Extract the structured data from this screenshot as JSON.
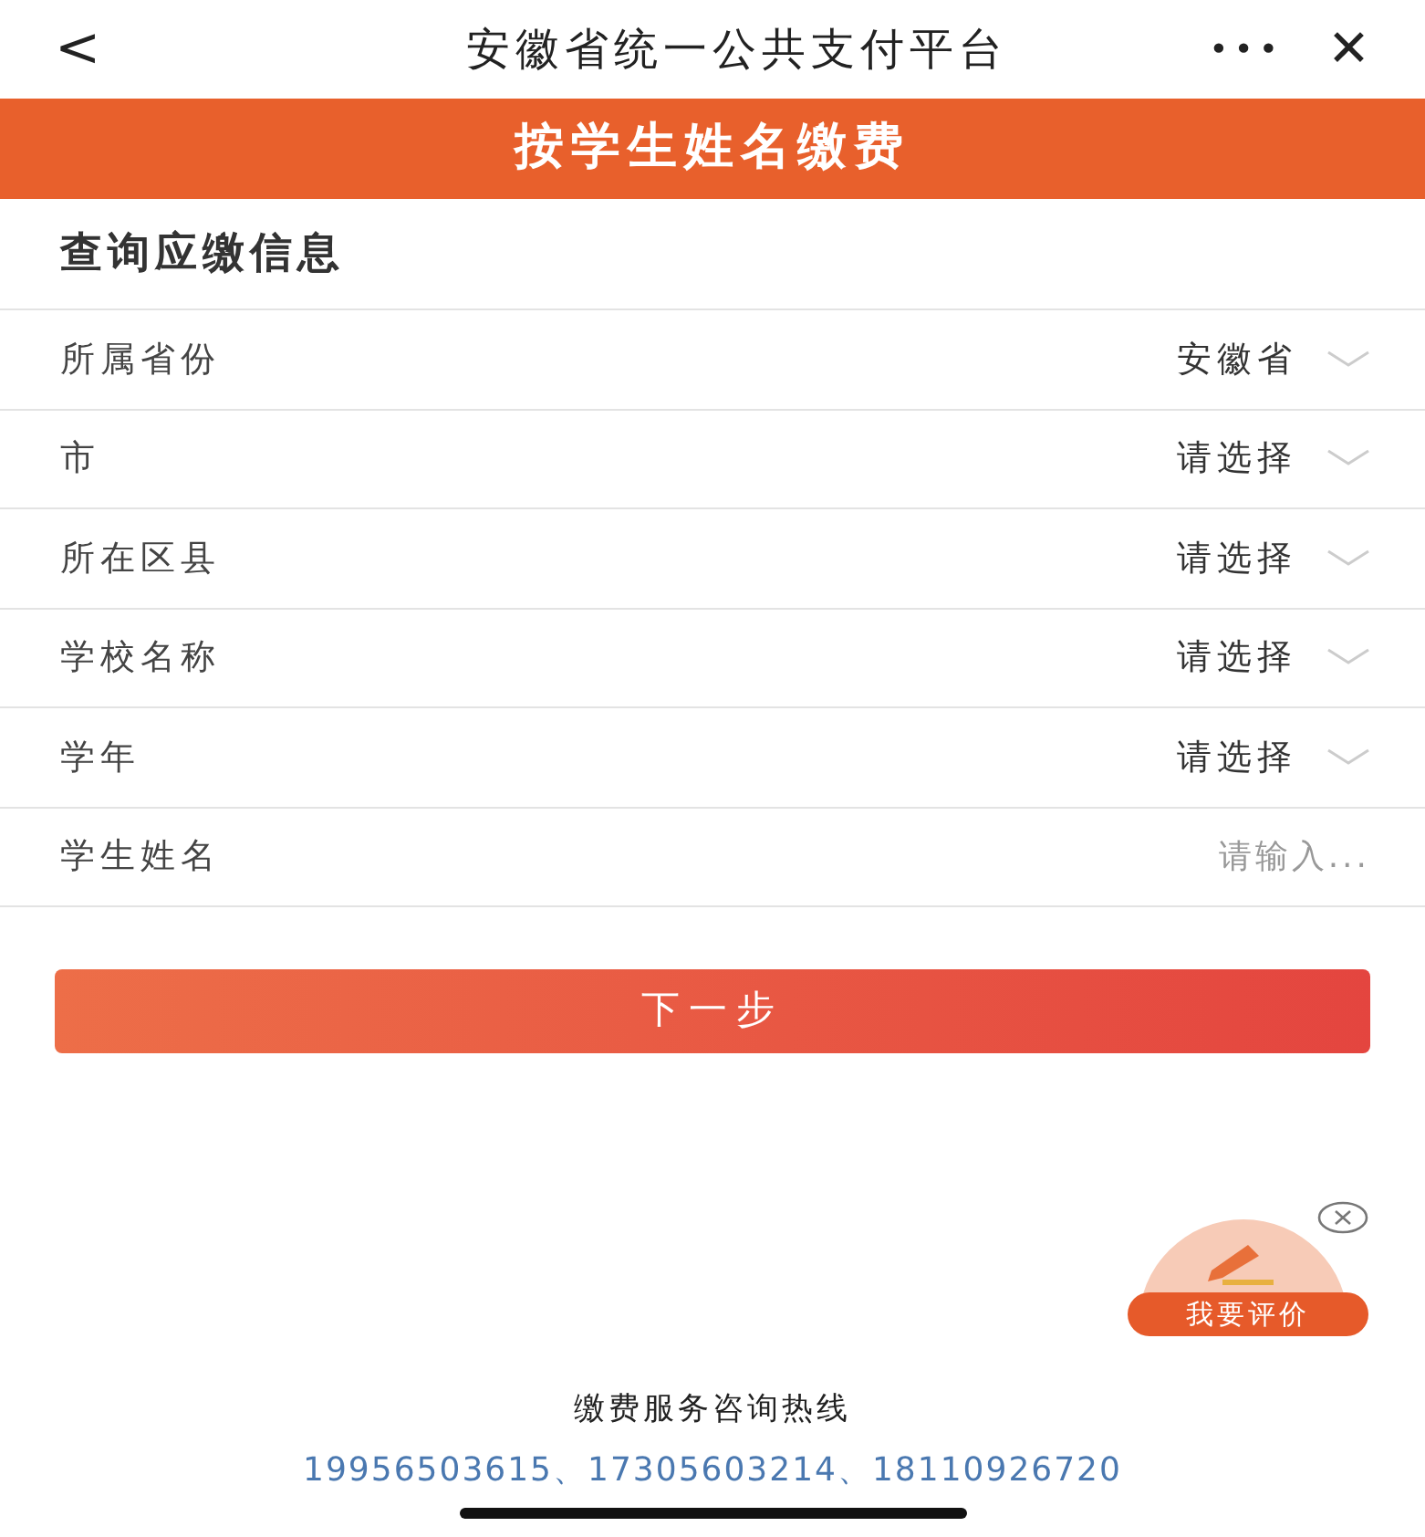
{
  "top_bar": {
    "back": "<",
    "title": "安徽省统一公共支付平台",
    "more": "•••",
    "close": "✕"
  },
  "banner": {
    "title": "按学生姓名缴费"
  },
  "section": {
    "title": "查询应缴信息"
  },
  "fields": [
    {
      "kind": "select",
      "label": "所属省份",
      "value": "安徽省"
    },
    {
      "kind": "select",
      "label": "市",
      "value": "请选择"
    },
    {
      "kind": "select",
      "label": "所在区县",
      "value": "请选择"
    },
    {
      "kind": "select",
      "label": "学校名称",
      "value": "请选择"
    },
    {
      "kind": "select",
      "label": "学年",
      "value": "请选择"
    },
    {
      "kind": "input",
      "label": "学生姓名",
      "placeholder": "请输入..."
    }
  ],
  "next_button": "下一步",
  "feedback": {
    "label": "我要评价"
  },
  "hotline": {
    "title": "缴费服务咨询热线",
    "numbers": "19956503615、17305603214、18110926720"
  }
}
